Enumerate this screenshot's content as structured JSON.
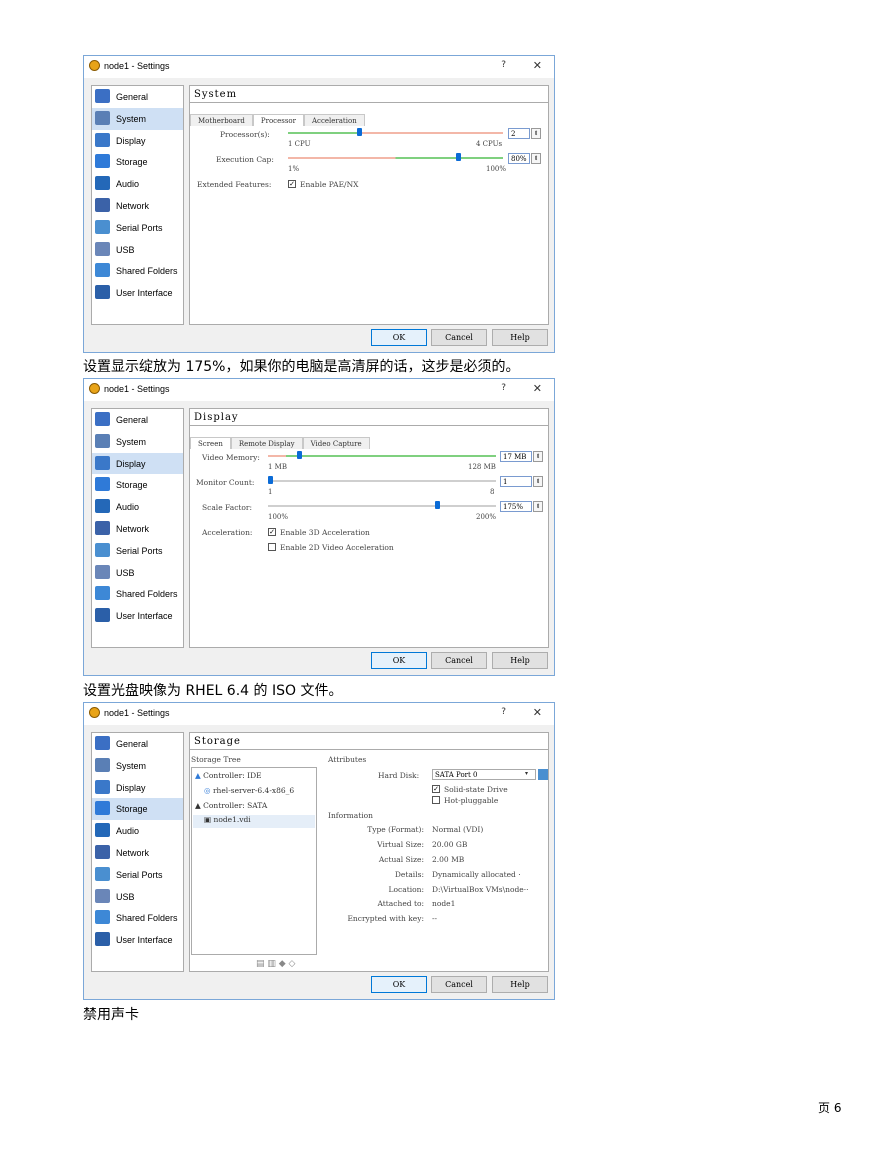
{
  "page": {
    "captions": [
      "设置显示绽放为 175%，如果你的电脑是高清屏的话，这步是必须的。",
      "设置光盘映像为 RHEL 6.4 的 ISO 文件。",
      "禁用声卡"
    ],
    "page_number": "页 6"
  },
  "dialog": {
    "title": "node1 - Settings",
    "help_glyph": "?",
    "close_glyph": "✕",
    "sidebar": [
      {
        "label": "General",
        "icon": "general-icon",
        "color": "#3b6fc4"
      },
      {
        "label": "System",
        "icon": "system-icon",
        "color": "#5a7fb5"
      },
      {
        "label": "Display",
        "icon": "display-icon",
        "color": "#3a78c9"
      },
      {
        "label": "Storage",
        "icon": "storage-icon",
        "color": "#2f7ad8"
      },
      {
        "label": "Audio",
        "icon": "audio-icon",
        "color": "#2468b8"
      },
      {
        "label": "Network",
        "icon": "network-icon",
        "color": "#3b62a8"
      },
      {
        "label": "Serial Ports",
        "icon": "serial-ports-icon",
        "color": "#4a8fd0"
      },
      {
        "label": "USB",
        "icon": "usb-icon",
        "color": "#6a86b8"
      },
      {
        "label": "Shared Folders",
        "icon": "shared-folders-icon",
        "color": "#3d88d6"
      },
      {
        "label": "User Interface",
        "icon": "user-interface-icon",
        "color": "#2b5fa8"
      }
    ],
    "buttons": {
      "ok": "OK",
      "cancel": "Cancel",
      "help": "Help"
    }
  },
  "system_panel": {
    "title": "System",
    "tabs": [
      "Motherboard",
      "Processor",
      "Acceleration"
    ],
    "processor_label": "Processor(s):",
    "processor_min": "1 CPU",
    "processor_max": "4 CPUs",
    "processor_value": "2",
    "processor_fraction": 0.33,
    "cap_label": "Execution Cap:",
    "cap_min": "1%",
    "cap_max": "100%",
    "cap_value": "80%",
    "cap_fraction": 0.8,
    "ext_label": "Extended Features:",
    "ext_option": "Enable PAE/NX",
    "ext_checked": true
  },
  "display_panel": {
    "title": "Display",
    "tabs": [
      "Screen",
      "Remote Display",
      "Video Capture"
    ],
    "vmem_label": "Video Memory:",
    "vmem_min": "1 MB",
    "vmem_max": "128 MB",
    "vmem_value": "17 MB",
    "vmem_fraction": 0.13,
    "monitor_label": "Monitor Count:",
    "monitor_min": "1",
    "monitor_max": "8",
    "monitor_value": "1",
    "monitor_fraction": 0.0,
    "scale_label": "Scale Factor:",
    "scale_min": "100%",
    "scale_max": "200%",
    "scale_value": "175%",
    "scale_fraction": 0.75,
    "accel_label": "Acceleration:",
    "accel_3d": "Enable 3D Acceleration",
    "accel_3d_checked": true,
    "accel_2d": "Enable 2D Video Acceleration",
    "accel_2d_checked": false
  },
  "storage_panel": {
    "title": "Storage",
    "tree_label": "Storage Tree",
    "tree": [
      "Controller: IDE",
      "rhel-server-6.4-x86_6",
      "Controller: SATA",
      "node1.vdi"
    ],
    "attributes_label": "Attributes",
    "hard_disk_label": "Hard Disk:",
    "hard_disk_value": "SATA Port 0",
    "ssd_label": "Solid-state Drive",
    "ssd_checked": true,
    "hotplug_label": "Hot-pluggable",
    "hotplug_checked": false,
    "info_label": "Information",
    "info_keys": [
      "Type (Format):",
      "Virtual Size:",
      "Actual Size:",
      "Details:",
      "Location:",
      "Attached to:",
      "Encrypted with key:"
    ],
    "info_values": [
      "Normal (VDI)",
      "20.00 GB",
      "2.00 MB",
      "Dynamically allocated ·",
      "D:\\VirtualBox VMs\\node··",
      "node1",
      "--"
    ]
  }
}
